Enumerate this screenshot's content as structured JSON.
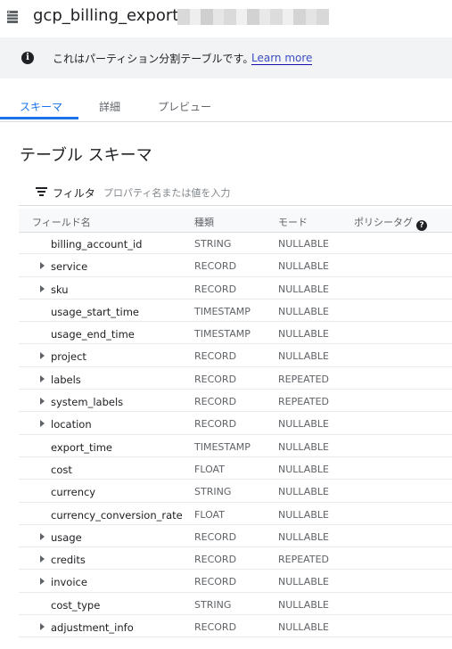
{
  "header": {
    "title": "gcp_billing_export_v1_",
    "icon": "table-icon"
  },
  "info": {
    "text": "これはパーティション分割テーブルです。",
    "link": "Learn more"
  },
  "tabs": [
    {
      "label": "スキーマ",
      "active": true
    },
    {
      "label": "詳細",
      "active": false
    },
    {
      "label": "プレビュー",
      "active": false
    }
  ],
  "schema": {
    "title": "テーブル スキーマ",
    "filter_label": "フィルタ",
    "filter_placeholder": "プロパティ名または値を入力",
    "columns": [
      "フィールド名",
      "種類",
      "モード",
      "ポリシータグ"
    ],
    "rows": [
      {
        "name": "billing_account_id",
        "type": "STRING",
        "mode": "NULLABLE",
        "expandable": false
      },
      {
        "name": "service",
        "type": "RECORD",
        "mode": "NULLABLE",
        "expandable": true
      },
      {
        "name": "sku",
        "type": "RECORD",
        "mode": "NULLABLE",
        "expandable": true
      },
      {
        "name": "usage_start_time",
        "type": "TIMESTAMP",
        "mode": "NULLABLE",
        "expandable": false
      },
      {
        "name": "usage_end_time",
        "type": "TIMESTAMP",
        "mode": "NULLABLE",
        "expandable": false
      },
      {
        "name": "project",
        "type": "RECORD",
        "mode": "NULLABLE",
        "expandable": true
      },
      {
        "name": "labels",
        "type": "RECORD",
        "mode": "REPEATED",
        "expandable": true
      },
      {
        "name": "system_labels",
        "type": "RECORD",
        "mode": "REPEATED",
        "expandable": true
      },
      {
        "name": "location",
        "type": "RECORD",
        "mode": "NULLABLE",
        "expandable": true
      },
      {
        "name": "export_time",
        "type": "TIMESTAMP",
        "mode": "NULLABLE",
        "expandable": false
      },
      {
        "name": "cost",
        "type": "FLOAT",
        "mode": "NULLABLE",
        "expandable": false
      },
      {
        "name": "currency",
        "type": "STRING",
        "mode": "NULLABLE",
        "expandable": false
      },
      {
        "name": "currency_conversion_rate",
        "type": "FLOAT",
        "mode": "NULLABLE",
        "expandable": false
      },
      {
        "name": "usage",
        "type": "RECORD",
        "mode": "NULLABLE",
        "expandable": true
      },
      {
        "name": "credits",
        "type": "RECORD",
        "mode": "REPEATED",
        "expandable": true
      },
      {
        "name": "invoice",
        "type": "RECORD",
        "mode": "NULLABLE",
        "expandable": true
      },
      {
        "name": "cost_type",
        "type": "STRING",
        "mode": "NULLABLE",
        "expandable": false
      },
      {
        "name": "adjustment_info",
        "type": "RECORD",
        "mode": "NULLABLE",
        "expandable": true
      }
    ]
  },
  "colors": {
    "accent": "#1a73e8",
    "infobar": "#f1f3f4",
    "link": "#3c4bc4"
  }
}
